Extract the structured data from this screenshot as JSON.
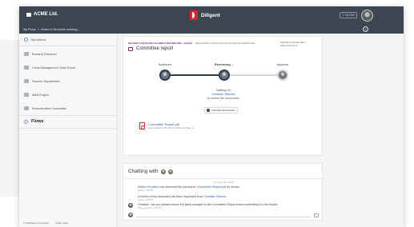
{
  "header": {
    "org_name": "ACME Ltd.",
    "brand": "Diligent",
    "filter_label": "FILTER"
  },
  "breadcrumb": {
    "items": [
      "My Flows",
      ">",
      "Board of Directors meeting..."
    ]
  },
  "help_icon": "?",
  "sidebar": {
    "items": [
      {
        "label": "My Actions"
      },
      {
        "label": "Board of Directors"
      },
      {
        "label": "Crisis Management Team Room"
      },
      {
        "label": "Finance Department"
      },
      {
        "label": "M&A Project"
      },
      {
        "label": "Remuneration Committee"
      }
    ],
    "flows_label": "Flows",
    "footer": [
      "© 2019 Diligent Corporation",
      "Privacy notice"
    ]
  },
  "document": {
    "meta_tag": "DELIVERY FOR BOARD OF DIRECTORS MEETING - Q3 2019",
    "meta_rest": "· REQUESTED 14 MINUTES AGO BY WILLEM GERRITSEN",
    "status_line1": "WAITING FOR REVIEW",
    "status_line2": "DUE IN 15 DAYS",
    "title": "Committee report"
  },
  "workflow": {
    "stages": [
      "Authored",
      "Reviewing ...",
      "Approve"
    ],
    "waiting_text": "Waiting for",
    "waiting_name": "Christian Starnes",
    "waiting_suffix": "to review the document.",
    "cancel_label": "CANCEL INVITATION"
  },
  "attachment": {
    "name": "Committee Report.pdf",
    "meta": "Last modified 11:56 2019 by Willem Gerritsen 1"
  },
  "chat": {
    "title": "Chatting with",
    "date": "Fri, Aug 21st, 2019",
    "messages": [
      {
        "author": "Willem Gerritsen",
        "text": " has delivered the document ",
        "doc": "Committee Report.pdf",
        "tail": " for review.",
        "sub": "System, 1:56 PM"
      },
      {
        "text": "A review of the document has been requested from ",
        "name": "Christian Starnes",
        "tail": ".",
        "sub": "System, 1:56 PM"
      },
      {
        "text": "Christian, can you please review the latest changes to the Committee Report before submitting it to the Board.",
        "sub": "Willem Gerritsen, 1:56 PM"
      }
    ],
    "input_placeholder": ""
  },
  "colors": {
    "topbar": "#3c4651",
    "accent": "#2b3d55",
    "brand_red": "#e0212f",
    "link": "#2869b8",
    "tag_purple": "#7a2d73"
  }
}
